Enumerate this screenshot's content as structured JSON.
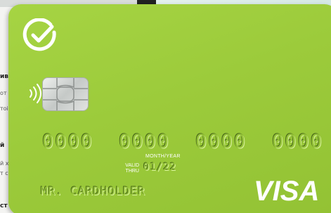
{
  "background": {
    "left_page_lines": [
      "ив",
      "от",
      "тоі",
      "й",
      "й х",
      "т с.",
      "ст"
    ]
  },
  "card": {
    "color": "#9ccb3b",
    "logo_icon": "sber-check-logo",
    "contactless_icon": "contactless-icon",
    "number_groups": [
      "0000",
      "0000",
      "0000",
      "0000"
    ],
    "month_year_label": "MONTH/YEAR",
    "valid_thru_line1": "VALID",
    "valid_thru_line2": "THRU",
    "expiry": "01/22",
    "holder": "MR. CARDHOLDER",
    "network": "VISA"
  }
}
